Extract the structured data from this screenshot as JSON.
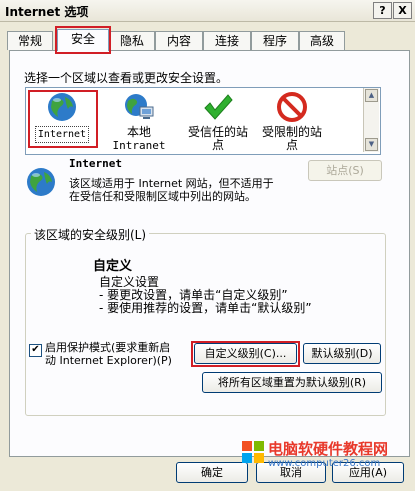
{
  "window": {
    "title": "Internet 选项",
    "help_btn": "?",
    "close_btn": "X"
  },
  "tabs": [
    {
      "label": "常规"
    },
    {
      "label": "安全"
    },
    {
      "label": "隐私"
    },
    {
      "label": "内容"
    },
    {
      "label": "连接"
    },
    {
      "label": "程序"
    },
    {
      "label": "高级"
    }
  ],
  "zones": {
    "prompt": "选择一个区域以查看或更改安全设置。",
    "items": [
      {
        "line1": "Internet",
        "line2": ""
      },
      {
        "line1": "本地",
        "line2": "Intranet"
      },
      {
        "line1": "受信任的站",
        "line2": "点"
      },
      {
        "line1": "受限制的站",
        "line2": "点"
      }
    ]
  },
  "zone_info": {
    "name": "Internet",
    "desc1": "该区域适用于 Internet 网站，但不适用于",
    "desc2": "在受信任和受限制区域中列出的网站。",
    "sites_button": "站点(S)"
  },
  "security": {
    "group_label": "该区域的安全级别(L)",
    "level_title": "自定义",
    "lines": [
      "自定义设置",
      "- 要更改设置，请单击“自定义级别”",
      "- 要使用推荐的设置，请单击“默认级别”"
    ],
    "protected_mode_line1": "启用保护模式(要求重新启",
    "protected_mode_line2": "动 Internet Explorer)(P)",
    "protected_checked": "✔",
    "custom_button": "自定义级别(C)...",
    "default_button": "默认级别(D)",
    "reset_button": "将所有区域重置为默认级别(R)"
  },
  "footer": {
    "ok": "确定",
    "cancel": "取消",
    "apply": "应用(A)"
  },
  "watermark": {
    "line1": "电脑软硬件教程网",
    "line2": "www.computer26.com"
  },
  "colors": {
    "highlight": "#D11E25",
    "dialog_bg": "#ECE9D8"
  }
}
